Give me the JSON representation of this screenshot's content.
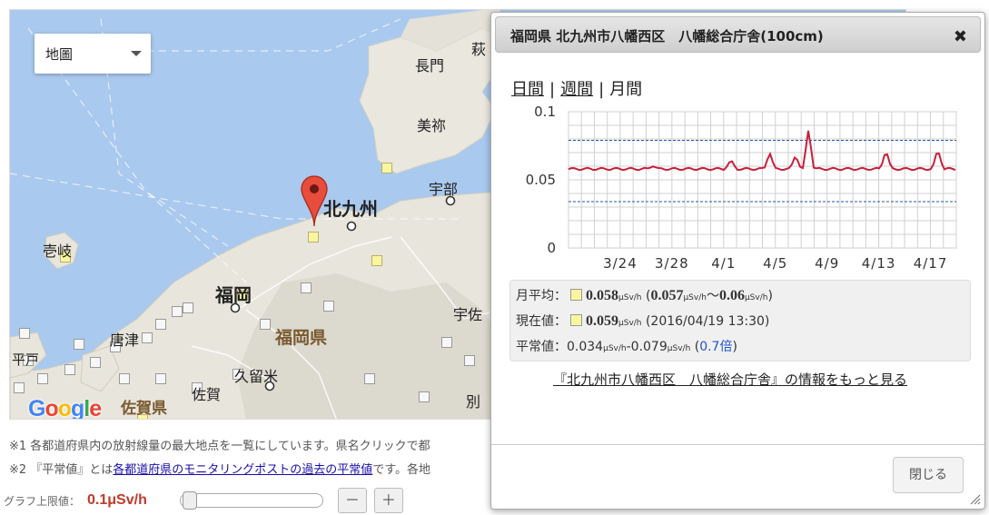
{
  "map": {
    "maptype": "地圖",
    "google_logo": "Google",
    "place_labels": [
      {
        "text": "長門",
        "kind": "city"
      },
      {
        "text": "美祢",
        "kind": "city"
      },
      {
        "text": "宇部",
        "kind": "city"
      },
      {
        "text": "北九州",
        "kind": "major"
      },
      {
        "text": "壱岐",
        "kind": "city"
      },
      {
        "text": "福岡",
        "kind": "major"
      },
      {
        "text": "福岡県",
        "kind": "pref"
      },
      {
        "text": "唐津",
        "kind": "city"
      },
      {
        "text": "宇佐",
        "kind": "city"
      },
      {
        "text": "久留米",
        "kind": "city"
      },
      {
        "text": "佐賀",
        "kind": "city"
      },
      {
        "text": "佐賀県",
        "kind": "pref"
      },
      {
        "text": "平戸",
        "kind": "city"
      },
      {
        "text": "別",
        "kind": "city"
      },
      {
        "text": "萩",
        "kind": "city"
      }
    ]
  },
  "notes": {
    "note1": "※1 各都道府県内の放射線量の最大地点を一覧にしています。県名クリックで都",
    "note2_prefix": "※2 『平常値』とは",
    "note2_link": "各都道府県のモニタリングポストの過去の平常値",
    "note2_suffix": "です。各地"
  },
  "graph_control": {
    "label": "グラフ上限値：",
    "value": "0.1μSv/h",
    "slider_fraction": 0.0,
    "minus": "－",
    "plus": "＋"
  },
  "dialog": {
    "title": "福岡県 北九州市八幡西区　八幡総合庁舎(100cm)",
    "close_icon": "✖",
    "tabs": [
      {
        "label": "日間",
        "current": false
      },
      {
        "label": "週間",
        "current": false
      },
      {
        "label": "月間",
        "current": true
      }
    ],
    "tab_separator": "|",
    "stats": {
      "monthly_avg_label": "月平均：",
      "monthly_avg_value": "0.058",
      "monthly_range_open": "(",
      "monthly_min": "0.057",
      "monthly_range_sep": "〜",
      "monthly_max": "0.06",
      "monthly_range_close": ")",
      "current_label": "現在値：",
      "current_value": "0.059",
      "current_time": "(2016/04/19 13:30)",
      "normal_label": "平常値：",
      "normal_low": "0.034",
      "normal_sep": "-",
      "normal_high": "0.079",
      "normal_mult_open": "(",
      "normal_mult": "0.7倍",
      "normal_mult_close": ")",
      "unit": "μSv/h"
    },
    "more_link": "『北九州市八幡西区　八幡総合庁舎』の情報をもっと見る",
    "close_button": "閉じる"
  },
  "chart_data": {
    "type": "line",
    "title": "",
    "xlabel": "",
    "ylabel": "",
    "ylim": [
      0,
      0.1
    ],
    "yticks": [
      "0",
      "0.05",
      "0.1"
    ],
    "xlim_days": [
      "2016/03/20",
      "2016/04/19"
    ],
    "xticks": [
      "3/24",
      "3/28",
      "4/1",
      "4/5",
      "4/9",
      "4/13",
      "4/17"
    ],
    "reference_lines": [
      0.079,
      0.034
    ],
    "grid": true,
    "colors": {
      "line": "#c8203a",
      "reference": "#2255aa"
    },
    "series": [
      {
        "x": [
          "3/20",
          "3/21",
          "3/22",
          "3/23",
          "3/24",
          "3/25",
          "3/26",
          "3/27",
          "3/28",
          "3/29",
          "3/30",
          "3/31",
          "4/1",
          "4/2",
          "4/3",
          "4/4",
          "4/5",
          "4/6",
          "4/7",
          "4/8",
          "4/9",
          "4/10",
          "4/11",
          "4/12",
          "4/13",
          "4/14",
          "4/15",
          "4/16",
          "4/17",
          "4/18",
          "4/19"
        ],
        "values": [
          0.058,
          0.058,
          0.058,
          0.058,
          0.058,
          0.058,
          0.059,
          0.058,
          0.058,
          0.058,
          0.058,
          0.058,
          0.058,
          0.064,
          0.058,
          0.058,
          0.058,
          0.072,
          0.058,
          0.058,
          0.058,
          0.058,
          0.058,
          0.058,
          0.058,
          0.058,
          0.058,
          0.058,
          0.058,
          0.058,
          0.058
        ],
        "peaks": [
          [
            "3/26",
            0.06
          ],
          [
            "4/1",
            0.065
          ],
          [
            "4/4",
            0.07
          ],
          [
            "4/6",
            0.068
          ],
          [
            "4/7",
            0.087
          ],
          [
            "4/13",
            0.072
          ],
          [
            "4/17",
            0.073
          ]
        ]
      }
    ]
  }
}
